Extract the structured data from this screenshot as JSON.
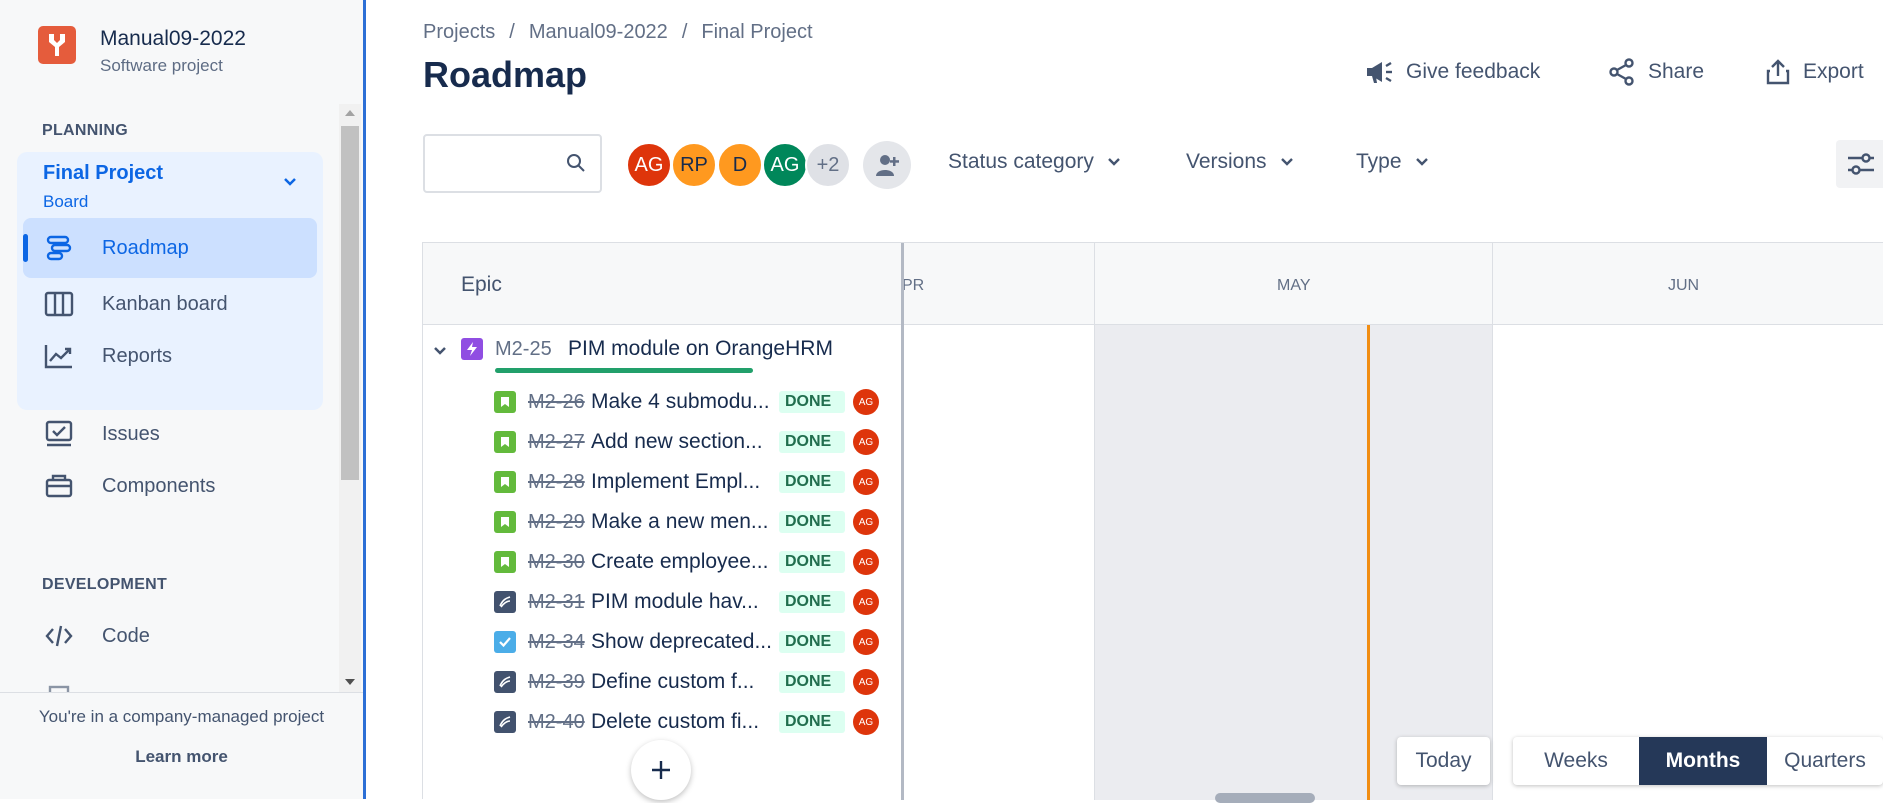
{
  "project": {
    "name": "Manual09-2022",
    "type": "Software project"
  },
  "sidebar": {
    "planning_label": "PLANNING",
    "group": {
      "title": "Final Project",
      "subtitle": "Board"
    },
    "items": [
      {
        "label": "Roadmap",
        "icon": "roadmap-icon",
        "active": true
      },
      {
        "label": "Kanban board",
        "icon": "board-icon"
      },
      {
        "label": "Reports",
        "icon": "reports-icon"
      },
      {
        "label": "Issues",
        "icon": "issues-icon"
      },
      {
        "label": "Components",
        "icon": "components-icon"
      }
    ],
    "development_label": "DEVELOPMENT",
    "dev_items": [
      {
        "label": "Code",
        "icon": "code-icon"
      }
    ],
    "footer": {
      "text": "You're in a company-managed project",
      "link": "Learn more"
    }
  },
  "breadcrumb": [
    "Projects",
    "Manual09-2022",
    "Final Project"
  ],
  "page_title": "Roadmap",
  "actions": {
    "feedback": "Give feedback",
    "share": "Share",
    "export": "Export"
  },
  "search": {
    "placeholder": ""
  },
  "avatars": [
    {
      "initials": "AG",
      "color": "#de350b"
    },
    {
      "initials": "RP",
      "color": "#ff991f"
    },
    {
      "initials": "D",
      "color": "#ff991f"
    },
    {
      "initials": "AG",
      "color": "#00875a"
    },
    {
      "initials": "+2",
      "color": "#dfe1e6"
    }
  ],
  "filters": {
    "status": "Status category",
    "versions": "Versions",
    "type": "Type"
  },
  "roadmap": {
    "column_header": "Epic",
    "months": [
      "PR",
      "MAY",
      "JUN"
    ],
    "epic": {
      "key": "M2-25",
      "summary": "PIM module on OrangeHRM"
    },
    "issues": [
      {
        "key": "M2-26",
        "summary": "Make 4 submodu...",
        "status": "DONE",
        "type": "story",
        "assignee": "AG"
      },
      {
        "key": "M2-27",
        "summary": "Add new section...",
        "status": "DONE",
        "type": "story",
        "assignee": "AG"
      },
      {
        "key": "M2-28",
        "summary": "Implement Empl...",
        "status": "DONE",
        "type": "story",
        "assignee": "AG"
      },
      {
        "key": "M2-29",
        "summary": "Make a new men...",
        "status": "DONE",
        "type": "story",
        "assignee": "AG"
      },
      {
        "key": "M2-30",
        "summary": "Create employee...",
        "status": "DONE",
        "type": "story",
        "assignee": "AG"
      },
      {
        "key": "M2-31",
        "summary": "PIM module hav...",
        "status": "DONE",
        "type": "subtask",
        "assignee": "AG"
      },
      {
        "key": "M2-34",
        "summary": "Show deprecated...",
        "status": "DONE",
        "type": "task",
        "assignee": "AG"
      },
      {
        "key": "M2-39",
        "summary": "Define custom f...",
        "status": "DONE",
        "type": "subtask",
        "assignee": "AG"
      },
      {
        "key": "M2-40",
        "summary": "Delete custom fi...",
        "status": "DONE",
        "type": "subtask",
        "assignee": "AG"
      }
    ]
  },
  "timeline_controls": {
    "today": "Today",
    "weeks": "Weeks",
    "months": "Months",
    "quarters": "Quarters",
    "selected": "Months"
  },
  "colors": {
    "accent": "#0c66e4",
    "done_text": "#216e4e",
    "today_line": "#f18d13",
    "epic": "#904ee2",
    "story": "#63ba3c"
  }
}
